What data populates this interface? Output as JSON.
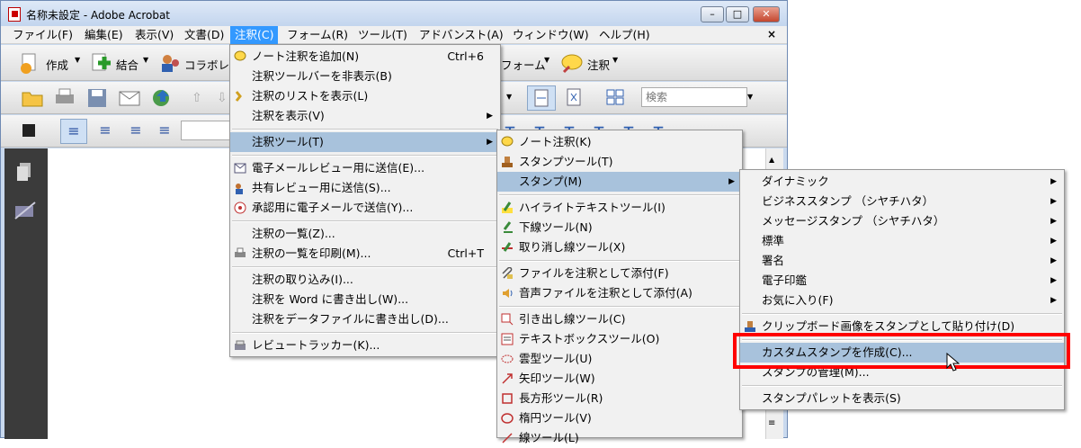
{
  "window": {
    "title": "名称未設定 - Adobe Acrobat",
    "min": "–",
    "max": "□",
    "close": "✕"
  },
  "menubar": [
    "ファイル(F)",
    "編集(E)",
    "表示(V)",
    "文書(D)",
    "注釈(C)",
    "フォーム(R)",
    "ツール(T)",
    "アドバンスト(A)",
    "ウィンドウ(W)",
    "ヘルプ(H)"
  ],
  "mdi_close": "×",
  "toolbar1": {
    "create": "作成",
    "combine": "結合",
    "collab": "コラボレ",
    "forms": "フォーム",
    "comment": "注釈"
  },
  "toolbar2": {
    "search_placeholder": "検索"
  },
  "comment_menu": {
    "items": [
      {
        "label": "ノート注釈を追加(N)",
        "shortcut": "Ctrl+6"
      },
      {
        "label": "注釈ツールバーを非表示(B)"
      },
      {
        "label": "注釈のリストを表示(L)"
      },
      {
        "label": "注釈を表示(V)"
      },
      {
        "label": "注釈ツール(T)"
      },
      {
        "label": "電子メールレビュー用に送信(E)..."
      },
      {
        "label": "共有レビュー用に送信(S)..."
      },
      {
        "label": "承認用に電子メールで送信(Y)..."
      },
      {
        "label": "注釈の一覧(Z)..."
      },
      {
        "label": "注釈の一覧を印刷(M)...",
        "shortcut": "Ctrl+T"
      },
      {
        "label": "注釈の取り込み(I)..."
      },
      {
        "label": "注釈を Word に書き出し(W)..."
      },
      {
        "label": "注釈をデータファイルに書き出し(D)..."
      },
      {
        "label": "レビュートラッカー(K)..."
      }
    ]
  },
  "tools_menu": {
    "items": [
      {
        "label": "ノート注釈(K)"
      },
      {
        "label": "スタンプツール(T)"
      },
      {
        "label": "スタンプ(M)"
      },
      {
        "label": "ハイライトテキストツール(I)"
      },
      {
        "label": "下線ツール(N)"
      },
      {
        "label": "取り消し線ツール(X)"
      },
      {
        "label": "ファイルを注釈として添付(F)"
      },
      {
        "label": "音声ファイルを注釈として添付(A)"
      },
      {
        "label": "引き出し線ツール(C)"
      },
      {
        "label": "テキストボックスツール(O)"
      },
      {
        "label": "雲型ツール(U)"
      },
      {
        "label": "矢印ツール(W)"
      },
      {
        "label": "長方形ツール(R)"
      },
      {
        "label": "楕円ツール(V)"
      },
      {
        "label": "線ツール(L)"
      }
    ]
  },
  "stamp_menu": {
    "items": [
      {
        "label": "ダイナミック"
      },
      {
        "label": "ビジネススタンプ （シヤチハタ）"
      },
      {
        "label": "メッセージスタンプ （シヤチハタ）"
      },
      {
        "label": "標準"
      },
      {
        "label": "署名"
      },
      {
        "label": "電子印鑑"
      },
      {
        "label": "お気に入り(F)"
      },
      {
        "label": "クリップボード画像をスタンプとして貼り付け(D)"
      },
      {
        "label": "カスタムスタンプを作成(C)..."
      },
      {
        "label": "スタンプの管理(M)..."
      },
      {
        "label": "スタンプパレットを表示(S)"
      }
    ]
  },
  "colors": {
    "highlight": "#a8c2dc",
    "callout": "#ff0000",
    "menu_active": "#3399ff"
  }
}
